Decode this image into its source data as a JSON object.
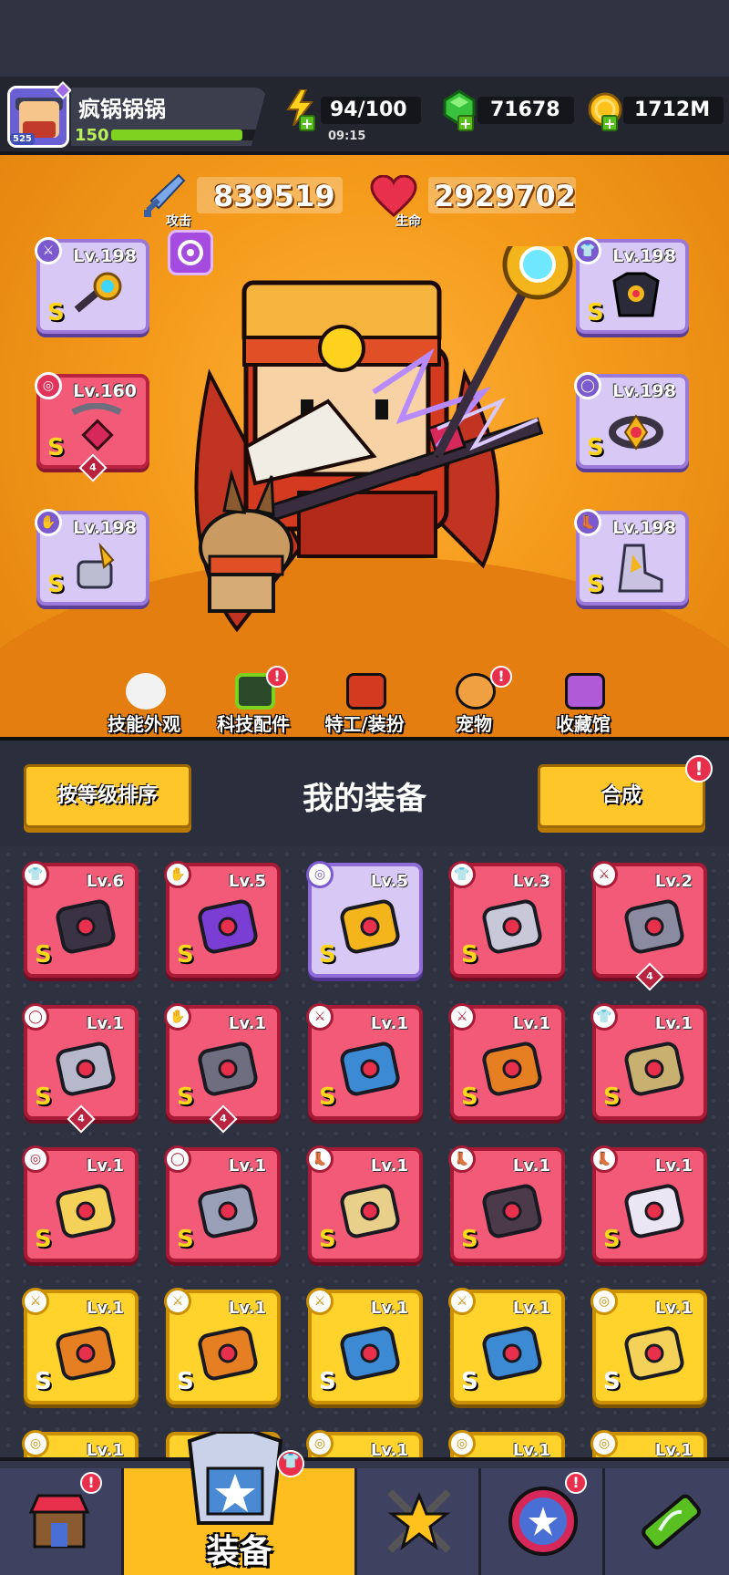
{
  "player": {
    "name": "疯锅锅锅",
    "avatar_level": "525",
    "level": "150",
    "xp_fraction": 0.9
  },
  "resources": {
    "energy": {
      "value": "94/100",
      "timer": "09:15"
    },
    "gems": {
      "value": "71678"
    },
    "coins": {
      "value": "1712M"
    }
  },
  "stats": {
    "attack": {
      "label": "攻击",
      "value": "839519"
    },
    "hp": {
      "label": "生命",
      "value": "2929702"
    }
  },
  "equipped": [
    {
      "level": "Lv.198",
      "rarity": "S",
      "slot_icon": "weapon-icon",
      "color": "purple",
      "item": "gear-staff-icon"
    },
    {
      "level": "Lv.160",
      "rarity": "S",
      "slot_icon": "necklace-icon",
      "color": "red",
      "item": "chain-necklace-icon",
      "stars": "4"
    },
    {
      "level": "Lv.198",
      "rarity": "S",
      "slot_icon": "glove-icon",
      "color": "purple",
      "item": "gauntlet-icon"
    },
    {
      "level": "Lv.198",
      "rarity": "S",
      "slot_icon": "armor-icon",
      "color": "purple",
      "item": "armor-icon"
    },
    {
      "level": "Lv.198",
      "rarity": "S",
      "slot_icon": "belt-icon",
      "color": "purple",
      "item": "belt-icon"
    },
    {
      "level": "Lv.198",
      "rarity": "S",
      "slot_icon": "boots-icon",
      "color": "purple",
      "item": "boots-icon"
    }
  ],
  "menu": [
    {
      "label": "技能外观",
      "icon": "skill-skin-icon",
      "alert": false
    },
    {
      "label": "科技配件",
      "icon": "tech-part-icon",
      "alert": true
    },
    {
      "label": "特工/装扮",
      "icon": "agent-icon",
      "alert": false
    },
    {
      "label": "宠物",
      "icon": "pet-dog-icon",
      "alert": true
    },
    {
      "label": "收藏馆",
      "icon": "collection-chest-icon",
      "alert": false
    }
  ],
  "section": {
    "title": "我的装备",
    "sort_button": "按等级排序",
    "merge_button": "合成",
    "merge_alert": "!"
  },
  "inventory": [
    {
      "level": "Lv.6",
      "rarity": "S",
      "color": "red",
      "icon": "armor-icon",
      "item": "dark-armor-icon"
    },
    {
      "level": "Lv.5",
      "rarity": "S",
      "color": "red",
      "icon": "glove-icon",
      "item": "purple-gauntlet-icon"
    },
    {
      "level": "Lv.5",
      "rarity": "S",
      "color": "purple",
      "icon": "necklace-icon",
      "item": "star-necklace-icon"
    },
    {
      "level": "Lv.3",
      "rarity": "S",
      "color": "red",
      "icon": "armor-icon",
      "item": "silver-armor-icon"
    },
    {
      "level": "Lv.2",
      "rarity": "",
      "color": "red",
      "icon": "weapon-icon",
      "item": "kunai-icon",
      "stars": "4"
    },
    {
      "level": "Lv.1",
      "rarity": "S",
      "color": "red",
      "icon": "belt-icon",
      "item": "orb-belt-icon",
      "stars": "4"
    },
    {
      "level": "Lv.1",
      "rarity": "S",
      "color": "red",
      "icon": "glove-icon",
      "item": "steel-gauntlet-icon",
      "stars": "4"
    },
    {
      "level": "Lv.1",
      "rarity": "S",
      "color": "red",
      "icon": "weapon-icon",
      "item": "water-gun-icon"
    },
    {
      "level": "Lv.1",
      "rarity": "S",
      "color": "red",
      "icon": "weapon-icon",
      "item": "blaster-icon"
    },
    {
      "level": "Lv.1",
      "rarity": "S",
      "color": "red",
      "icon": "armor-icon",
      "item": "mech-armor-icon"
    },
    {
      "level": "Lv.1",
      "rarity": "S",
      "color": "red",
      "icon": "necklace-icon",
      "item": "star-ring-icon"
    },
    {
      "level": "Lv.1",
      "rarity": "S",
      "color": "red",
      "icon": "belt-icon",
      "item": "hex-belt-icon"
    },
    {
      "level": "Lv.1",
      "rarity": "S",
      "color": "red",
      "icon": "boots-icon",
      "item": "gold-boots-icon"
    },
    {
      "level": "Lv.1",
      "rarity": "S",
      "color": "red",
      "icon": "boots-icon",
      "item": "dark-boots-icon"
    },
    {
      "level": "Lv.1",
      "rarity": "S",
      "color": "red",
      "icon": "boots-icon",
      "item": "white-boots-icon"
    },
    {
      "level": "Lv.1",
      "rarity": "S",
      "color": "yellow",
      "icon": "weapon-icon",
      "item": "sword-icon"
    },
    {
      "level": "Lv.1",
      "rarity": "S",
      "color": "yellow",
      "icon": "weapon-icon",
      "item": "sword-icon"
    },
    {
      "level": "Lv.1",
      "rarity": "S",
      "color": "yellow",
      "icon": "weapon-icon",
      "item": "water-gun-icon"
    },
    {
      "level": "Lv.1",
      "rarity": "S",
      "color": "yellow",
      "icon": "weapon-icon",
      "item": "water-gun-icon"
    },
    {
      "level": "Lv.1",
      "rarity": "S",
      "color": "yellow",
      "icon": "necklace-icon",
      "item": "star-ring-icon"
    },
    {
      "level": "Lv.1",
      "rarity": "",
      "color": "yellow",
      "icon": "necklace-icon",
      "item": "partial"
    },
    {
      "level": "",
      "rarity": "",
      "color": "yellow",
      "icon": "",
      "item": "partial"
    },
    {
      "level": "Lv.1",
      "rarity": "",
      "color": "yellow",
      "icon": "necklace-icon",
      "item": "partial"
    },
    {
      "level": "Lv.1",
      "rarity": "",
      "color": "yellow",
      "icon": "necklace-icon",
      "item": "partial"
    },
    {
      "level": "Lv.1",
      "rarity": "",
      "color": "yellow",
      "icon": "necklace-icon",
      "item": "partial"
    }
  ],
  "bottom_nav": [
    {
      "label": "",
      "icon": "shop-icon",
      "alert": true,
      "active": false
    },
    {
      "label": "装备",
      "icon": "equipment-icon",
      "alert": true,
      "active": true
    },
    {
      "label": "",
      "icon": "battle-swords-icon",
      "alert": false,
      "active": false
    },
    {
      "label": "",
      "icon": "star-orb-icon",
      "alert": true,
      "active": false
    },
    {
      "label": "",
      "icon": "dna-capsule-icon",
      "alert": false,
      "active": false
    }
  ],
  "colors": {
    "rarity_red": "#f25a78",
    "rarity_purple": "#d8c8f6",
    "rarity_yellow": "#ffd22c",
    "accent_yellow": "#ffc629",
    "alert_red": "#e8304d"
  }
}
